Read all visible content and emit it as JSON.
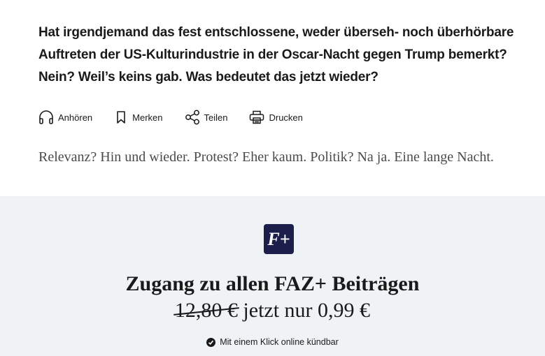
{
  "article": {
    "lead": "Hat irgendjemand das fest entschlossene, weder überseh- noch überhörbare Auftreten der US-Kulturindustrie in der Oscar-Nacht gegen Trump bemerkt? Nein? Weil’s keins gab. Was bedeutet das jetzt wieder?",
    "body": "Relevanz? Hin und wieder. Protest? Eher kaum. Politik? Na ja. Eine lange Nacht."
  },
  "actions": {
    "listen": {
      "label": "Anhören",
      "icon": "headphones-icon"
    },
    "bookmark": {
      "label": "Merken",
      "icon": "bookmark-icon"
    },
    "share": {
      "label": "Teilen",
      "icon": "share-icon"
    },
    "print": {
      "label": "Drucken",
      "icon": "printer-icon"
    }
  },
  "paywall": {
    "logo_text": "F+",
    "headline": "Zugang zu allen FAZ+ Beiträgen",
    "old_price": "12,80 €",
    "price_text": "jetzt nur 0,99 €",
    "benefit": "Mit einem Klick online kündbar",
    "colors": {
      "background": "#f0f3f5",
      "logo_bg": "#1b1f4a"
    }
  }
}
